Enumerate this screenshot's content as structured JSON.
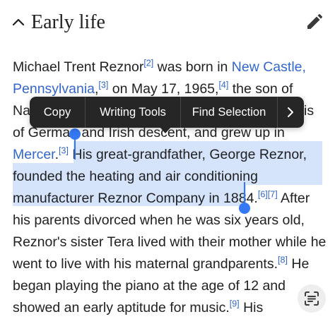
{
  "section": {
    "title": "Early life",
    "collapse_icon": "chevron-up-icon",
    "edit_icon": "pencil-icon"
  },
  "paragraph": {
    "l1": {
      "t1": "Michael Trent Reznor",
      "r1": "[2]",
      "t2": " was born in ",
      "a1": "New Castle,"
    },
    "l2": {
      "a1": "Pennsylvania",
      "t1": ",",
      "r1": "[3]",
      "t2": " on May 17, 1965,",
      "r2": "[4]",
      "t3": " the son of"
    },
    "l3": {
      "t1": "Na",
      "t2": "is"
    },
    "l4": {
      "t1": "of German and Irish descent, and grew up in"
    },
    "l5": {
      "a1": "Mercer",
      "t1": ".",
      "r1": "[3]",
      "t2": " His great-grandfather, George Reznor,"
    },
    "l6": {
      "t1": "founded the heating and air conditioning"
    },
    "l7": {
      "t1": "manufacturer Reznor Company in 1884.",
      "r1": "[6]",
      "r2": "[7]",
      "t2": " After"
    },
    "l8": {
      "t1": "his parents divorced when he was six years old,"
    },
    "l9": {
      "t1": "Reznor's sister Tera lived with their mother while he"
    },
    "l10": {
      "t1": "went to live with his maternal grandparents.",
      "r1": "[8]",
      "t2": " He"
    },
    "l11": {
      "t1": "began playing the piano at the age of 12 and"
    },
    "l12": {
      "t1": "showed an early aptitude for music.",
      "r1": "[9]",
      "t2": " His"
    }
  },
  "context_menu": {
    "items": [
      "Copy",
      "Writing Tools",
      "Find Selection"
    ],
    "more_icon": "chevron-right-icon"
  },
  "floating_button": {
    "icon": "text-scan-icon"
  },
  "colors": {
    "link": "#3366cc",
    "selection": "#d5e3fb",
    "handle": "#3478f6",
    "menu_bg": "#262626",
    "text": "#202122"
  }
}
